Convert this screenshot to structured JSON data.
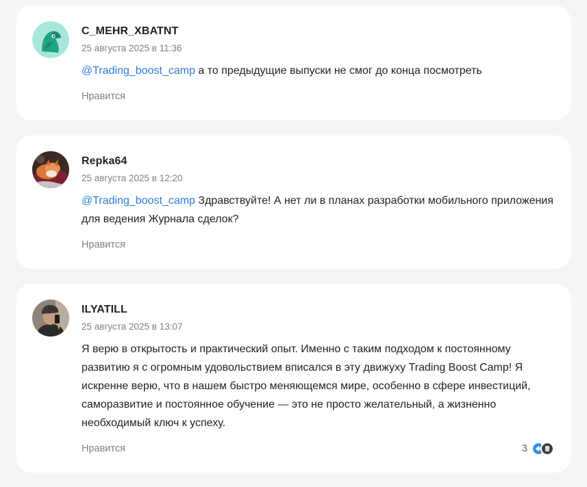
{
  "comments": [
    {
      "author": "C_MEHR_XBATNT",
      "date": "25 августа 2025 в 11:36",
      "mention": "@Trading_boost_camp",
      "text": " а то предыдущие выпуски не смог до конца посмотреть",
      "like_label": "Нравится"
    },
    {
      "author": "Repka64",
      "date": "25 августа 2025 в 12:20",
      "mention": "@Trading_boost_camp",
      "text": " Здравствуйте! А нет ли в планах разработки мобильного приложения для ведения Журнала сделок?",
      "like_label": "Нравится"
    },
    {
      "author": "ILYATILL",
      "date": "25 августа 2025 в 13:07",
      "text": "Я верю в открытость и практический опыт. Именно с таким подходом к постоянному развитию я с огромным удовольствием вписался в эту движуху Trading Boost Camp! Я искренне верю, что в нашем быстро меняющемся мире, особенно в сфере инвестиций, саморазвитие и постоянное обучение — это не просто желательный, а жизненно необходимый ключ к успеху.",
      "like_label": "Нравится",
      "reactions_count": "3"
    }
  ]
}
